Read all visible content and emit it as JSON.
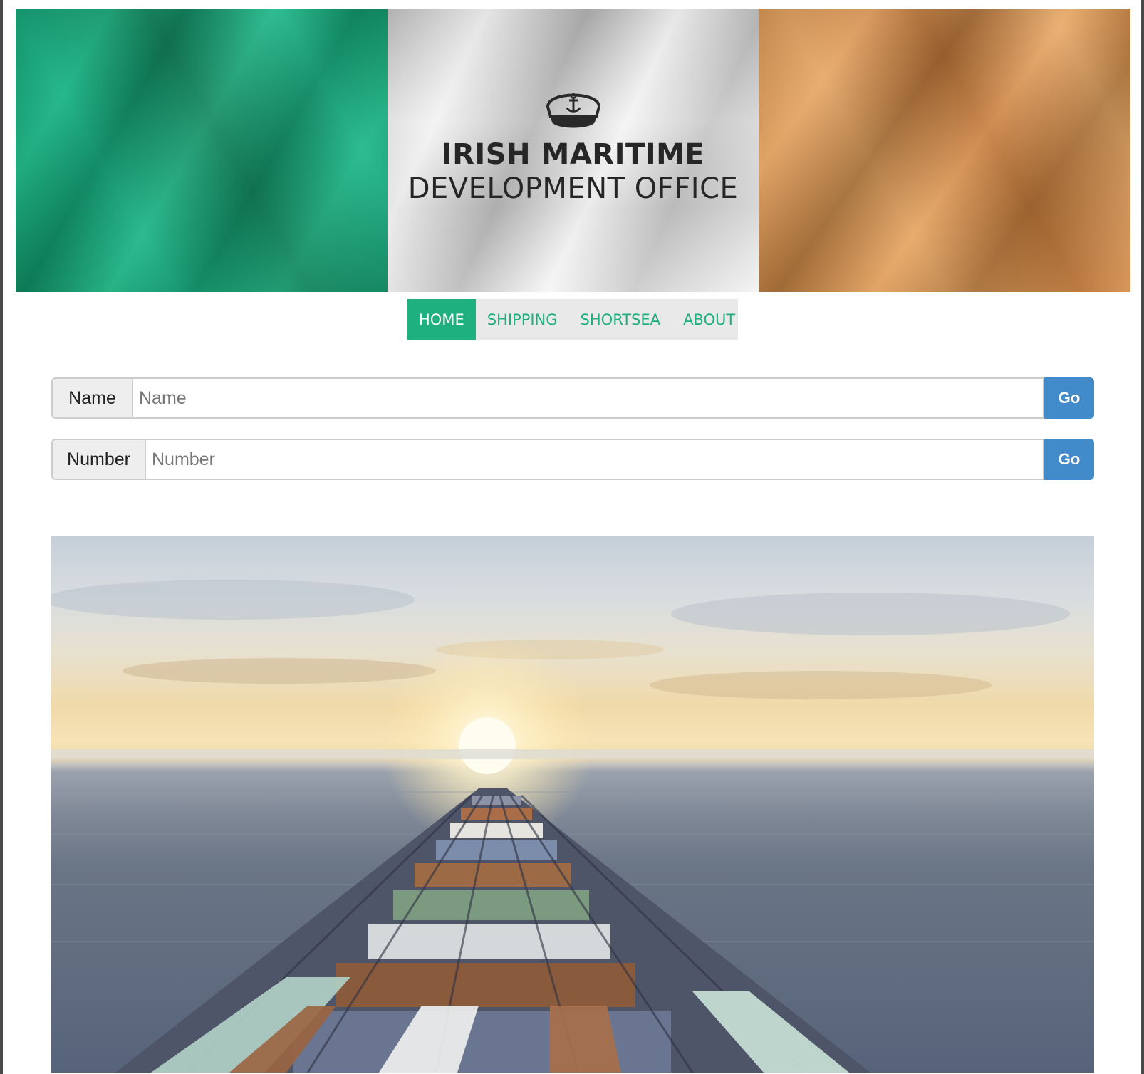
{
  "header": {
    "title_line1": "IRISH MARITIME",
    "title_line2": "DEVELOPMENT OFFICE",
    "logo_icon": "captain-hat-anchor-icon",
    "flag_colors": {
      "green": "#1ab585",
      "white": "#e5e5e5",
      "orange": "#e3a05d"
    }
  },
  "nav": {
    "items": [
      {
        "label": "HOME",
        "active": true
      },
      {
        "label": "SHIPPING",
        "active": false
      },
      {
        "label": "SHORTSEA",
        "active": false
      },
      {
        "label": "ABOUT",
        "active": false
      }
    ],
    "accent": "#1fb080"
  },
  "search": {
    "name": {
      "label": "Name",
      "placeholder": "Name",
      "value": "",
      "button": "Go"
    },
    "number": {
      "label": "Number",
      "placeholder": "Number",
      "value": "",
      "button": "Go"
    },
    "button_color": "#428bca"
  },
  "hero": {
    "image": "container-ship-sunset-photo"
  }
}
